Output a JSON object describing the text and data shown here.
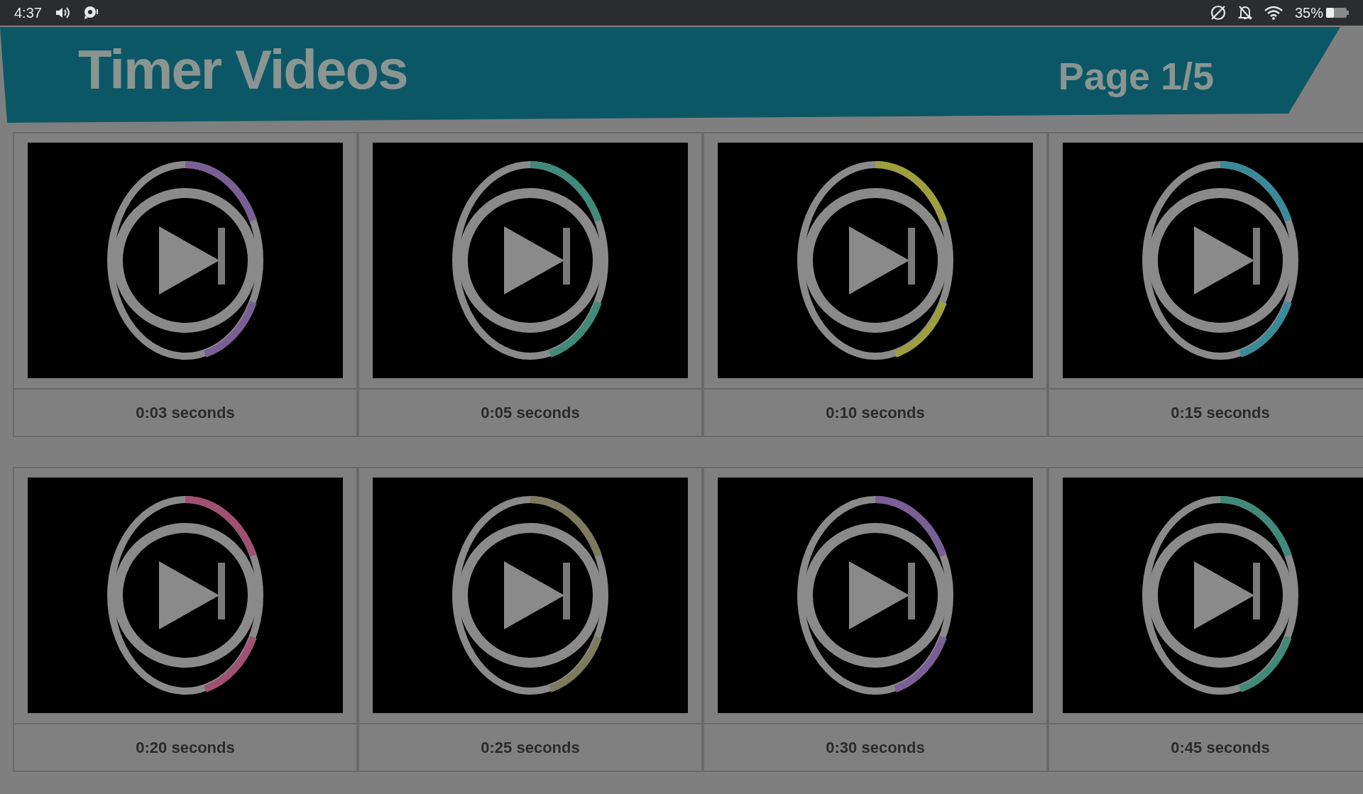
{
  "status_bar": {
    "time": "4:37",
    "battery": "35%"
  },
  "header": {
    "title": "Timer Videos",
    "page": "Page 1/5"
  },
  "videos": [
    {
      "caption": "0:03 seconds"
    },
    {
      "caption": "0:05 seconds"
    },
    {
      "caption": "0:10 seconds"
    },
    {
      "caption": "0:15 seconds"
    },
    {
      "caption": "0:20 seconds"
    },
    {
      "caption": "0:25 seconds"
    },
    {
      "caption": "0:30 seconds"
    },
    {
      "caption": "0:45 seconds"
    }
  ]
}
